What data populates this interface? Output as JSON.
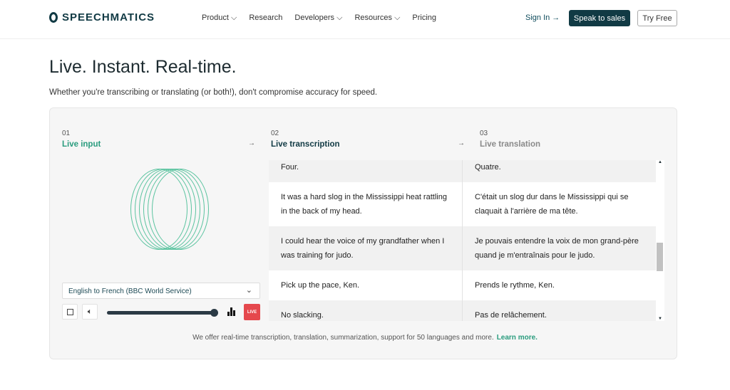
{
  "nav": {
    "brand": "SPEECHMATICS",
    "items": [
      "Product ⌵",
      "Research",
      "Developers ⌵",
      "Resources ⌵",
      "Pricing"
    ],
    "sign_in": "Sign In →",
    "speak_to_sales": "Speak to sales",
    "try_free": "Try Free"
  },
  "hero": {
    "title": "Live. Instant. Real-time.",
    "subtitle": "Whether you're transcribing or translating (or both!), don't compromise accuracy for speed."
  },
  "steps": [
    {
      "num": "01",
      "label": "Live input",
      "color": "#2a9c7e"
    },
    {
      "num": "02",
      "label": "Live transcription",
      "color": "#113a44"
    },
    {
      "num": "03",
      "label": "Live translation",
      "color": "#8a8a8a"
    }
  ],
  "controls": {
    "source": "English to French (BBC World Service)",
    "live": "LIVE",
    "volume_percent": 100
  },
  "rows": [
    {
      "en": "Four.",
      "fr": "Quatre."
    },
    {
      "en": "It was a hard slog in the Mississippi heat rattling in the back of my head.",
      "fr": "C'était un slog dur dans le Mississippi qui se claquait à l'arrière de ma tête."
    },
    {
      "en": "I could hear the voice of my grandfather when I was training for judo.",
      "fr": "Je pouvais entendre la voix de mon grand-père quand je m'entraînais pour le judo."
    },
    {
      "en": "Pick up the pace, Ken.",
      "fr": "Prends le rythme, Ken."
    },
    {
      "en": "No slacking.",
      "fr": "Pas de relâchement."
    }
  ],
  "footer": {
    "text": "We offer real-time transcription, translation, summarization, support for 50 languages and more.",
    "link": "Learn more."
  }
}
